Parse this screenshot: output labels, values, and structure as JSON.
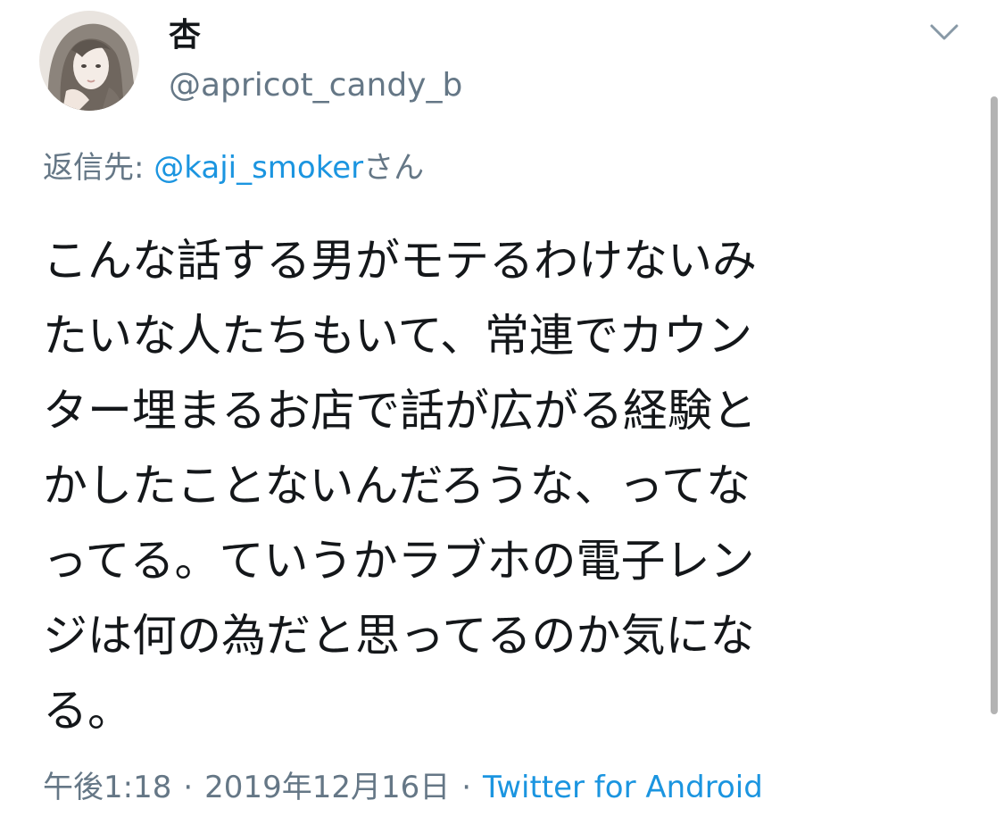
{
  "user": {
    "display_name": "杏",
    "handle": "@apricot_candy_b",
    "avatar_icon": "avatar-portrait"
  },
  "reply": {
    "prefix": "返信先: ",
    "mention": "@kaji_smoker",
    "suffix": "さん"
  },
  "tweet": {
    "lines": [
      "こんな話する男がモテるわけないみ",
      "たいな人たちもいて、常連でカウン",
      "ター埋まるお店で話が広がる経験と",
      "かしたことないんだろうな、ってな",
      "ってる。ていうかラブホの電子レン",
      "ジは何の為だと思ってるのか気にな",
      "る。"
    ]
  },
  "meta": {
    "time": "午後1:18",
    "separator": "·",
    "date": "2019年12月16日",
    "source": "Twitter for Android"
  },
  "controls": {
    "more_icon": "chevron-down-icon"
  },
  "colors": {
    "text": "#14171a",
    "secondary": "#657786",
    "link": "#1b95e0"
  }
}
